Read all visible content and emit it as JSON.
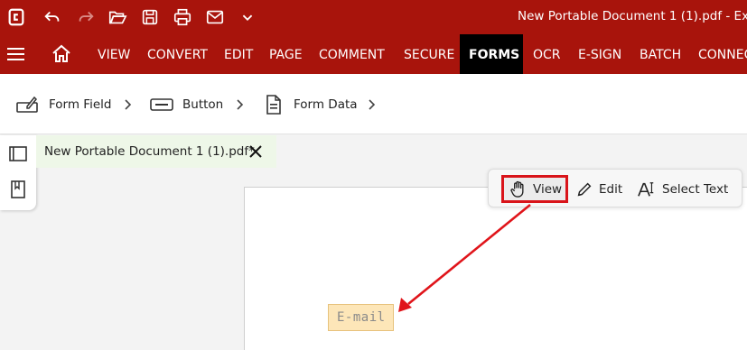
{
  "window": {
    "title": "New Portable Document 1 (1).pdf  -  Exp"
  },
  "quick_access": [
    {
      "icon": "app-logo-icon"
    },
    {
      "icon": "undo-icon"
    },
    {
      "icon": "redo-icon"
    },
    {
      "icon": "open-folder-icon"
    },
    {
      "icon": "save-icon"
    },
    {
      "icon": "print-icon"
    },
    {
      "icon": "email-icon"
    },
    {
      "icon": "chevron-down-icon"
    }
  ],
  "ribbon": {
    "tabs": [
      {
        "label": "VIEW"
      },
      {
        "label": "CONVERT"
      },
      {
        "label": "EDIT"
      },
      {
        "label": "PAGE"
      },
      {
        "label": "COMMENT"
      },
      {
        "label": "SECURE"
      },
      {
        "label": "FORMS",
        "active": true
      },
      {
        "label": "OCR"
      },
      {
        "label": "E-SIGN"
      },
      {
        "label": "BATCH"
      },
      {
        "label": "CONNEC"
      }
    ]
  },
  "forms_toolbar": {
    "items": [
      {
        "label": "Form Field",
        "icon": "form-field-icon"
      },
      {
        "label": "Button",
        "icon": "button-icon"
      },
      {
        "label": "Form Data",
        "icon": "form-data-icon"
      }
    ]
  },
  "document_tab": {
    "label": "New Portable Document 1 (1).pdf*"
  },
  "mode_toolbar": {
    "view": "View",
    "edit": "Edit",
    "select_text": "Select Text"
  },
  "canvas": {
    "email_field_text": "E-mail"
  },
  "colors": {
    "brand_red": "#a8140c",
    "active_tab": "#000000",
    "annotation_red": "#d9141a",
    "field_fill": "#fde6b8",
    "doc_tab_bg": "#eef7e8"
  }
}
